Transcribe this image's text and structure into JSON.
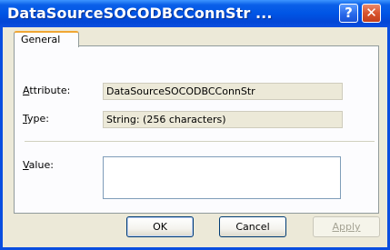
{
  "window": {
    "title": "DataSourceSOCODBCConnStr ...",
    "help_button": "?",
    "close_button": "✕"
  },
  "tabs": [
    {
      "label": "General",
      "selected": true
    }
  ],
  "fields": {
    "attribute": {
      "label_first": "A",
      "label_rest": "ttribute:",
      "value": "DataSourceSOCODBCConnStr"
    },
    "type": {
      "label_first": "T",
      "label_rest": "ype:",
      "value": "String: (256 characters)"
    },
    "value": {
      "label_first": "V",
      "label_rest": "alue:",
      "value": ""
    }
  },
  "buttons": {
    "ok": "OK",
    "cancel": "Cancel",
    "apply": "Apply"
  },
  "colors": {
    "titlebar": "#0055e5",
    "tab_accent": "#f0a634",
    "close_button": "#d8542e"
  }
}
